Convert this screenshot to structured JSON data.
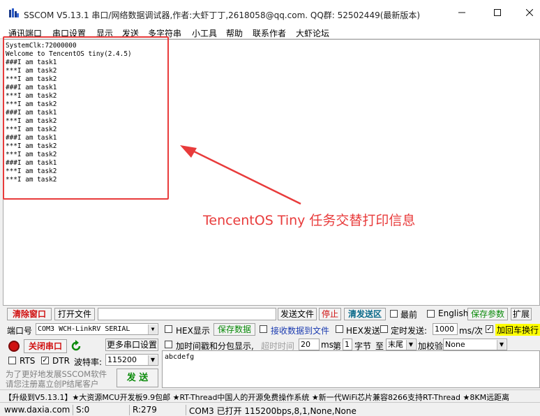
{
  "window": {
    "title": "SSCOM V5.13.1 串口/网络数据调试器,作者:大虾丁丁,2618058@qq.com. QQ群: 52502449(最新版本)"
  },
  "menu": [
    "通讯端口",
    "串口设置",
    "显示",
    "发送",
    "多字符串",
    "小工具",
    "帮助",
    "联系作者",
    "大虾论坛"
  ],
  "receive": {
    "lines": [
      "SystemClk:72000000",
      "Welcome to TencentOS tiny(2.4.5)",
      "###I am task1",
      "***I am task2",
      "***I am task2",
      "###I am task1",
      "***I am task2",
      "***I am task2",
      "###I am task1",
      "***I am task2",
      "***I am task2",
      "###I am task1",
      "***I am task2",
      "***I am task2",
      "###I am task1",
      "***I am task2",
      "***I am task2"
    ]
  },
  "annotation": {
    "text": "TencentOS Tiny 任务交替打印信息",
    "color": "#e83b3b"
  },
  "toolbar1": {
    "clear_window": "清除窗口",
    "open_file": "打开文件",
    "file_path": "",
    "send_file": "发送文件",
    "stop": "停止",
    "clear_send": "清发送区",
    "topmost": "最前",
    "english": "English",
    "save_params": "保存参数",
    "expand": "扩展"
  },
  "row2": {
    "port_label": "端口号",
    "port_value": "COM3 WCH-LinkRV SERIAL",
    "hex_display": "HEX显示",
    "save_data": "保存数据",
    "recv_to_file": "接收数据到文件",
    "hex_send": "HEX发送",
    "timed_send": "定时发送:",
    "interval": "1000",
    "interval_unit": "ms/次",
    "append_crlf": "加回车换行"
  },
  "row3": {
    "close_port": "关闭串口",
    "more_settings": "更多串口设置",
    "timestamp": "加时间戳和分包显示,",
    "timeout_label": "超时时间",
    "timeout_value": "20",
    "timeout_unit": "ms",
    "byte_label_pre": "第",
    "byte_index": "1",
    "byte_label_post": "字节",
    "to_label": "至",
    "to_value": "末尾",
    "checksum_label": "加校验",
    "checksum_value": "None"
  },
  "row4": {
    "rts": "RTS",
    "dtr": "DTR",
    "baud_label": "波特率:",
    "baud_value": "115200"
  },
  "send": {
    "text": "abcdefg",
    "button": "发 送",
    "promo_line1": "为了更好地发展SSCOM软件",
    "promo_line2": "请您注册嘉立创P结尾客户"
  },
  "ad": {
    "text": "【升级到V5.13.1】★大资源MCU开发板9.9包邮 ★RT-Thread中国人的开源免费操作系统 ★新一代WiFi芯片兼容8266支持RT-Thread ★8KM远距离"
  },
  "status": {
    "website": "www.daxia.com",
    "sent": "S:0",
    "received": "R:279",
    "port_info": "COM3 已打开  115200bps,8,1,None,None"
  },
  "colors": {
    "red_accent": "#d01010",
    "green_accent": "#0a8a0a",
    "yellow_highlight": "#ffff00"
  }
}
